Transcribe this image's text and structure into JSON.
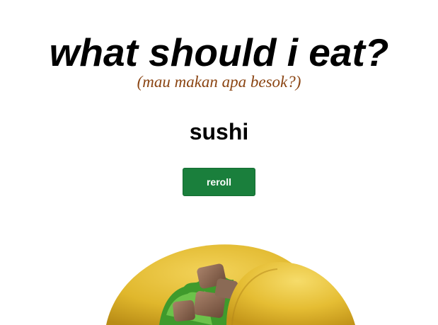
{
  "page": {
    "title": "what should i eat?",
    "subtitle": "(mau makan apa besok?)",
    "result": "sushi",
    "reroll_label": "reroll",
    "food_image_icon": "taco-icon"
  },
  "colors": {
    "subtitle": "#8b4513",
    "button": "#1a7f3c",
    "button_text": "#ffffff"
  }
}
